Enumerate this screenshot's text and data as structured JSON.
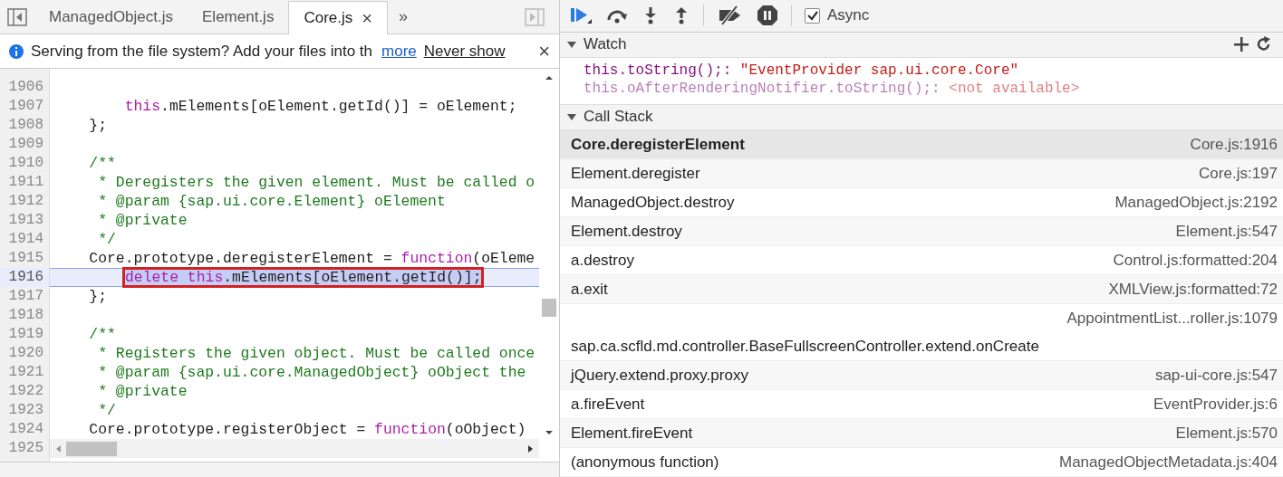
{
  "editor": {
    "tabs": [
      {
        "label": "ManagedObject.js",
        "selected": false
      },
      {
        "label": "Element.js",
        "selected": false
      },
      {
        "label": "Core.js",
        "selected": true,
        "close": "×"
      }
    ],
    "more_tabs": "»",
    "banner": {
      "text": "Serving from the file system? Add your files into th",
      "link": "more",
      "action": "Never show",
      "close": "×"
    },
    "lines": [
      {
        "number": "1906",
        "selected": false
      },
      {
        "number": "1907",
        "selected": false,
        "tokens": [
          {
            "kind": "keyword",
            "text": "        this"
          },
          {
            "kind": "plain",
            "text": ".mElements[oElement.getId()] = oElement;"
          }
        ]
      },
      {
        "number": "1908",
        "selected": false,
        "tokens": [
          {
            "kind": "plain",
            "text": "    };"
          }
        ]
      },
      {
        "number": "1909",
        "selected": false
      },
      {
        "number": "1910",
        "selected": false,
        "tokens": [
          {
            "kind": "comment",
            "text": "    /**"
          }
        ]
      },
      {
        "number": "1911",
        "selected": false,
        "tokens": [
          {
            "kind": "comment",
            "text": "     * Deregisters the given element. Must be called o"
          }
        ]
      },
      {
        "number": "1912",
        "selected": false,
        "tokens": [
          {
            "kind": "comment",
            "text": "     * @param {sap.ui.core.Element} oElement"
          }
        ]
      },
      {
        "number": "1913",
        "selected": false,
        "tokens": [
          {
            "kind": "comment",
            "text": "     * @private"
          }
        ]
      },
      {
        "number": "1914",
        "selected": false,
        "tokens": [
          {
            "kind": "comment",
            "text": "     */"
          }
        ]
      },
      {
        "number": "1915",
        "selected": false,
        "tokens": [
          {
            "kind": "plain",
            "text": "    Core.prototype.deregisterElement = "
          },
          {
            "kind": "keyword",
            "text": "function"
          },
          {
            "kind": "plain",
            "text": "(oEleme"
          }
        ]
      },
      {
        "number": "1916",
        "selected": true,
        "tokens": [
          {
            "kind": "keyword",
            "text": "delete"
          },
          {
            "kind": "keyword",
            "text": " this"
          },
          {
            "kind": "plain",
            "text": ".mElements[oElement.getId()];"
          }
        ]
      },
      {
        "number": "1917",
        "selected": false,
        "tokens": [
          {
            "kind": "plain",
            "text": "    };"
          }
        ]
      },
      {
        "number": "1918",
        "selected": false
      },
      {
        "number": "1919",
        "selected": false,
        "tokens": [
          {
            "kind": "comment",
            "text": "    /**"
          }
        ]
      },
      {
        "number": "1920",
        "selected": false,
        "tokens": [
          {
            "kind": "comment",
            "text": "     * Registers the given object. Must be called once"
          }
        ]
      },
      {
        "number": "1921",
        "selected": false,
        "tokens": [
          {
            "kind": "comment",
            "text": "     * @param {sap.ui.core.ManagedObject} oObject the"
          }
        ]
      },
      {
        "number": "1922",
        "selected": false,
        "tokens": [
          {
            "kind": "comment",
            "text": "     * @private"
          }
        ]
      },
      {
        "number": "1923",
        "selected": false,
        "tokens": [
          {
            "kind": "comment",
            "text": "     */"
          }
        ]
      },
      {
        "number": "1924",
        "selected": false,
        "tokens": [
          {
            "kind": "plain",
            "text": "    Core.prototype.registerObject = "
          },
          {
            "kind": "keyword",
            "text": "function"
          },
          {
            "kind": "plain",
            "text": "(oObject)"
          }
        ]
      },
      {
        "number": "1925",
        "selected": false
      }
    ]
  },
  "debugger": {
    "async": {
      "label": "Async",
      "checked": true
    },
    "watch": {
      "title": "Watch",
      "expanded": true,
      "items": [
        {
          "expression": "this.toString();:",
          "value": "\"EventProvider sap.ui.core.Core\"",
          "available": true
        },
        {
          "expression": "this.oAfterRenderingNotifier.toString();:",
          "value": "<not available>",
          "available": false
        }
      ]
    },
    "call_stack": {
      "title": "Call Stack",
      "expanded": true,
      "frames": [
        {
          "name": "Core.deregisterElement",
          "location": "Core.js:1916",
          "selected": true
        },
        {
          "name": "Element.deregister",
          "location": "Core.js:197",
          "selected": false
        },
        {
          "name": "ManagedObject.destroy",
          "location": "ManagedObject.js:2192",
          "selected": false
        },
        {
          "name": "Element.destroy",
          "location": "Element.js:547",
          "selected": false
        },
        {
          "name": "a.destroy",
          "location": "Control.js:formatted:204",
          "selected": false
        },
        {
          "name": "a.exit",
          "location": "XMLView.js:formatted:72",
          "selected": false
        },
        {
          "name": "sap.ca.scfld.md.controller.BaseFullscreenController.extend.onCreate",
          "location": "AppointmentList...roller.js:1079",
          "selected": false
        },
        {
          "name": "jQuery.extend.proxy.proxy",
          "location": "sap-ui-core.js:547",
          "selected": false
        },
        {
          "name": "a.fireEvent",
          "location": "EventProvider.js:6",
          "selected": false
        },
        {
          "name": "Element.fireEvent",
          "location": "Element.js:570",
          "selected": false
        },
        {
          "name": "(anonymous function)",
          "location": "ManagedObjectMetadata.js:404",
          "selected": false
        }
      ]
    }
  }
}
